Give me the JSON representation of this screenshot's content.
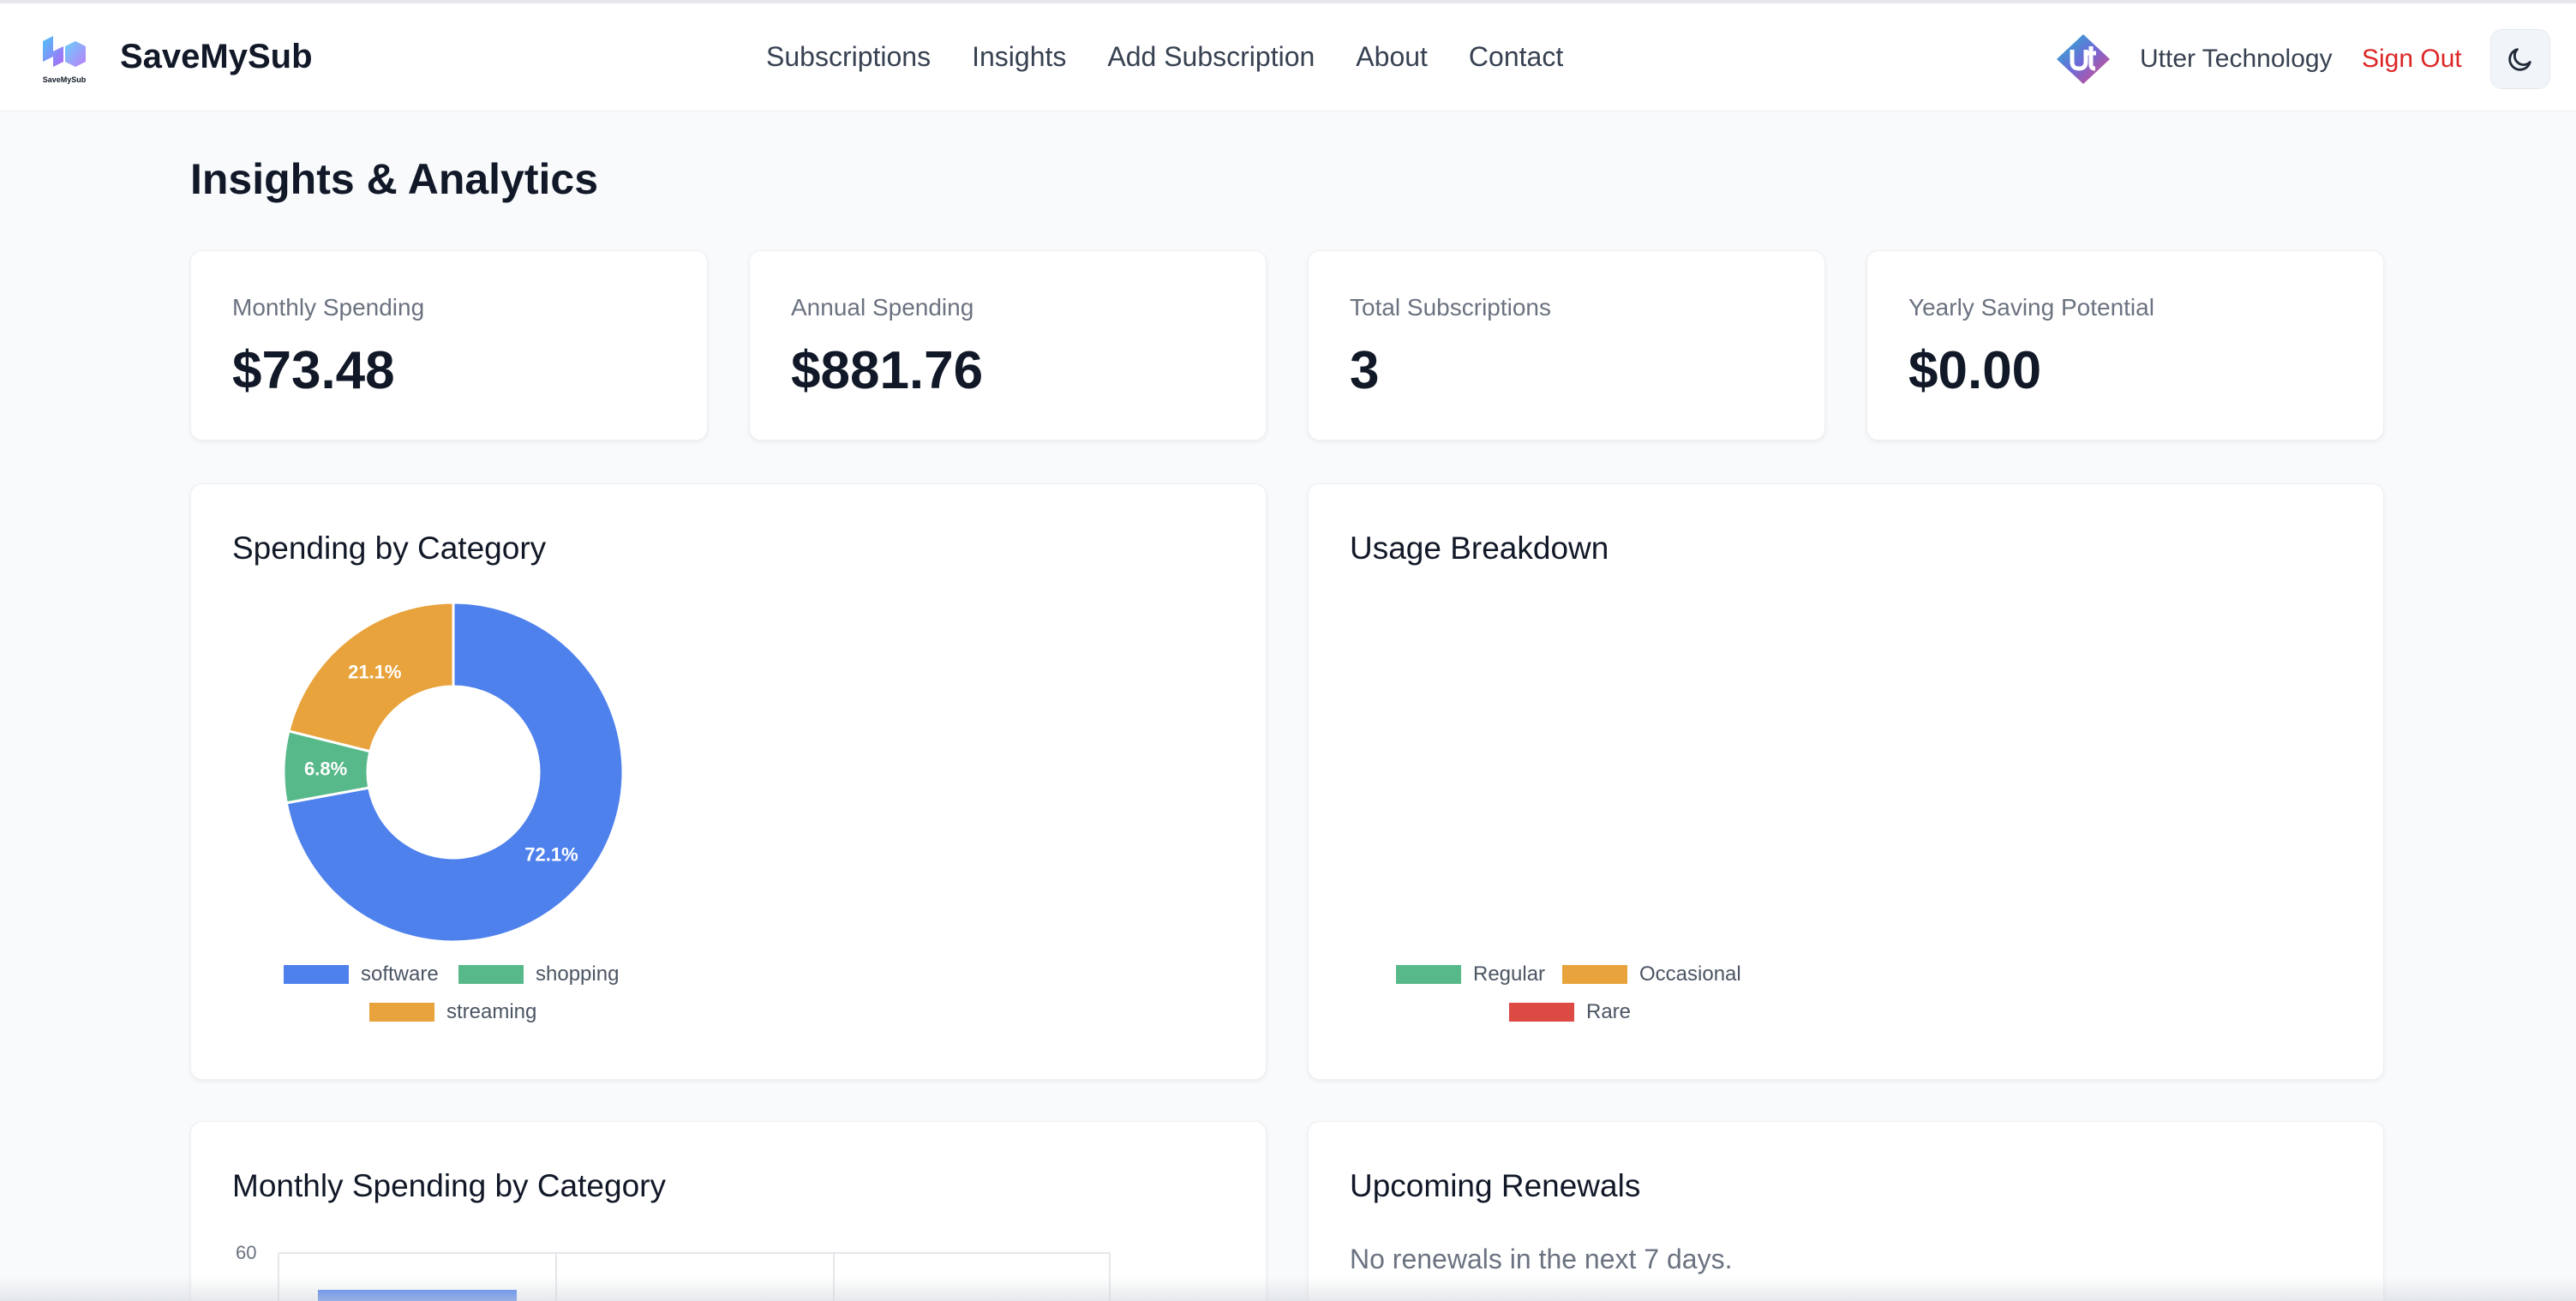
{
  "header": {
    "brand": "SaveMySub",
    "logo_text": "SaveMySub",
    "nav": [
      "Subscriptions",
      "Insights",
      "Add Subscription",
      "About",
      "Contact"
    ],
    "user_name": "Utter Technology",
    "sign_out": "Sign Out",
    "theme_icon": "moon-icon"
  },
  "page": {
    "title": "Insights & Analytics"
  },
  "stats": [
    {
      "label": "Monthly Spending",
      "value": "$73.48"
    },
    {
      "label": "Annual Spending",
      "value": "$881.76"
    },
    {
      "label": "Total Subscriptions",
      "value": "3"
    },
    {
      "label": "Yearly Saving Potential",
      "value": "$0.00"
    }
  ],
  "spending_by_category": {
    "title": "Spending by Category"
  },
  "usage_breakdown": {
    "title": "Usage Breakdown"
  },
  "monthly_by_category": {
    "title": "Monthly Spending by Category"
  },
  "upcoming_renewals": {
    "title": "Upcoming Renewals",
    "empty_text": "No renewals in the next 7 days."
  },
  "colors": {
    "software": "#4f81ed",
    "shopping": "#57b98a",
    "streaming": "#e8a33c",
    "regular": "#57b98a",
    "occasional": "#e8a33c",
    "rare": "#dc4a43",
    "sign_out": "#dc2626"
  },
  "chart_data": [
    {
      "type": "pie",
      "variant": "donut",
      "title": "Spending by Category",
      "categories": [
        "software",
        "shopping",
        "streaming"
      ],
      "values": [
        72.1,
        6.8,
        21.1
      ],
      "labels": [
        "72.1%",
        "6.8%",
        "21.1%"
      ],
      "legend": "bottom"
    },
    {
      "type": "pie",
      "title": "Usage Breakdown",
      "categories": [
        "Regular",
        "Occasional",
        "Rare"
      ],
      "values": [
        0,
        0,
        0
      ],
      "legend": "bottom"
    },
    {
      "type": "bar",
      "title": "Monthly Spending by Category",
      "ylim": [
        0,
        60
      ],
      "y_ticks": [
        "60"
      ],
      "grid": true
    }
  ]
}
